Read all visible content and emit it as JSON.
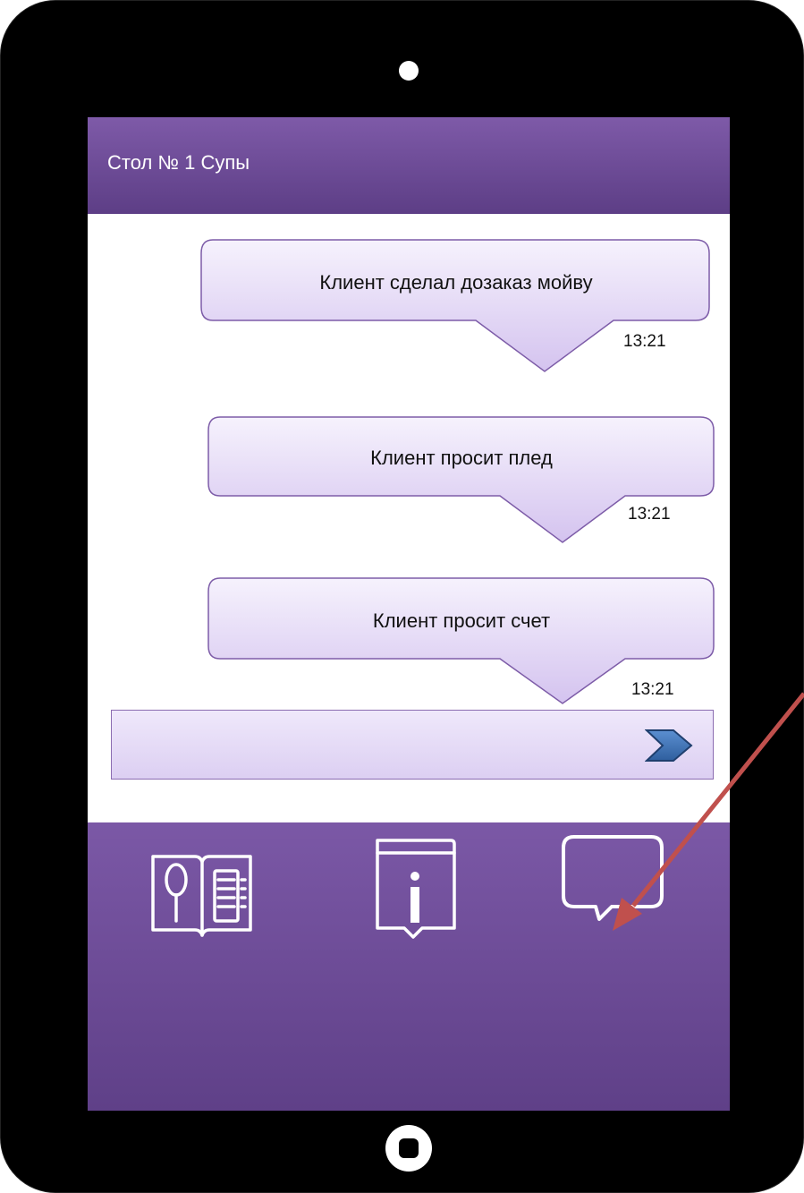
{
  "header": {
    "title": "Стол № 1 Супы"
  },
  "messages": [
    {
      "text": "Клиент сделал дозаказ мойву",
      "time": "13:21"
    },
    {
      "text": "Клиент просит плед",
      "time": "13:21"
    },
    {
      "text": "Клиент просит счет",
      "time": "13:21"
    }
  ],
  "input": {
    "value": ""
  },
  "tabs": [
    {
      "icon": "menu-book-icon"
    },
    {
      "icon": "info-icon"
    },
    {
      "icon": "chat-icon"
    }
  ],
  "colors": {
    "header": "#6b4a94",
    "bubble_fill": "#e6dcf7",
    "bubble_border": "#7d5ca8",
    "annotation_arrow": "#c0504d"
  }
}
